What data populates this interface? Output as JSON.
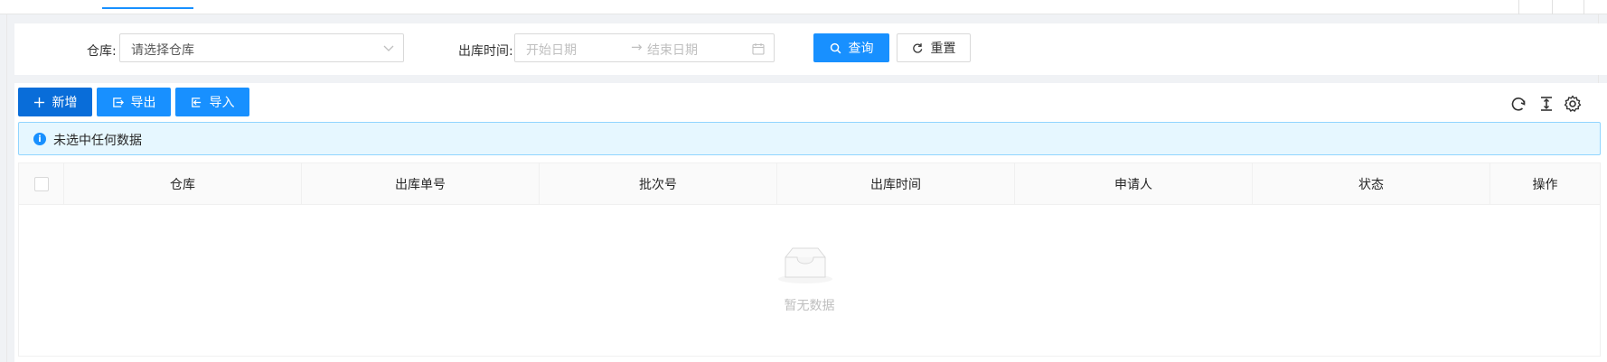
{
  "filter": {
    "warehouse_label": "仓库:",
    "warehouse_placeholder": "请选择仓库",
    "outbound_time_label": "出库时间:",
    "start_date_placeholder": "开始日期",
    "range_separator": "→",
    "end_date_placeholder": "结束日期",
    "query_label": "查询",
    "reset_label": "重置"
  },
  "toolbar": {
    "add_label": "新增",
    "export_label": "导出",
    "import_label": "导入"
  },
  "alert": {
    "message": "未选中任何数据"
  },
  "table": {
    "columns": [
      "仓库",
      "出库单号",
      "批次号",
      "出库时间",
      "申请人",
      "状态",
      "操作"
    ],
    "empty_text": "暂无数据"
  },
  "colors": {
    "primary": "#1890ff",
    "primary_dark": "#096dd9",
    "alert_bg": "#e6f7ff",
    "alert_border": "#91d5ff"
  }
}
